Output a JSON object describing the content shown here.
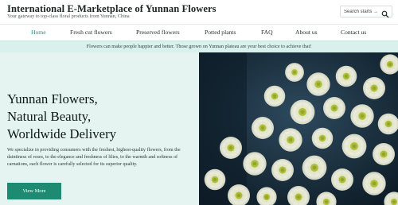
{
  "header": {
    "title": "International E-Marketplace of Yunnan Flowers",
    "tagline": "Your gateway to top-class floral products from Yunnan, China",
    "search_placeholder": "Search starts →"
  },
  "nav": {
    "items": [
      {
        "label": "Home",
        "active": true
      },
      {
        "label": "Fresh cut flowers"
      },
      {
        "label": "Preserved flowers"
      },
      {
        "label": "Potted plants"
      },
      {
        "label": "FAQ"
      },
      {
        "label": "About us"
      },
      {
        "label": "Contact us"
      }
    ]
  },
  "notice": {
    "text": "Flowers can make people happier and better. Those grown on Yunnan plateau are your best choice to achieve that!"
  },
  "hero": {
    "heading_lines": [
      "Yunnan Flowers,",
      "Natural Beauty,",
      "Worldwide Delivery"
    ],
    "description": "We specialize in providing consumers with the freshest, highest-quality flowers, from the daintiness of roses, to the elegance and freshness of lilies, to the warmth and softness of carnations, each flower is carefully selected for its superior quality.",
    "button_label": "View More",
    "image_icon": "chrysanthemum-photo"
  },
  "colors": {
    "accent": "#1f8a72",
    "nav_active": "#1e8a76",
    "notice_bg": "#d9f1ec",
    "hero_bg": "#e5f4f1"
  }
}
